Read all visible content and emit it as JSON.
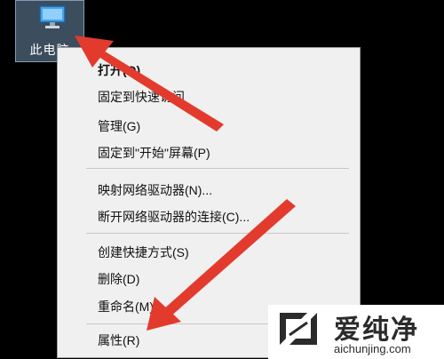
{
  "desktop_icon": {
    "label": "此电脑",
    "icon": "computer-icon"
  },
  "context_menu": {
    "groups": [
      [
        {
          "label": "打开(O)",
          "default": true
        },
        {
          "label": "固定到快速访问"
        },
        {
          "label": "管理(G)"
        },
        {
          "label": "固定到\"开始\"屏幕(P)"
        }
      ],
      [
        {
          "label": "映射网络驱动器(N)..."
        },
        {
          "label": "断开网络驱动器的连接(C)..."
        }
      ],
      [
        {
          "label": "创建快捷方式(S)"
        },
        {
          "label": "删除(D)"
        },
        {
          "label": "重命名(M)"
        }
      ],
      [
        {
          "label": "属性(R)"
        }
      ]
    ]
  },
  "annotation": {
    "arrow_color": "#e23b2e"
  },
  "watermark": {
    "name": "爱纯净",
    "url": "aichunjing.com",
    "color": "#2b2b2b"
  }
}
